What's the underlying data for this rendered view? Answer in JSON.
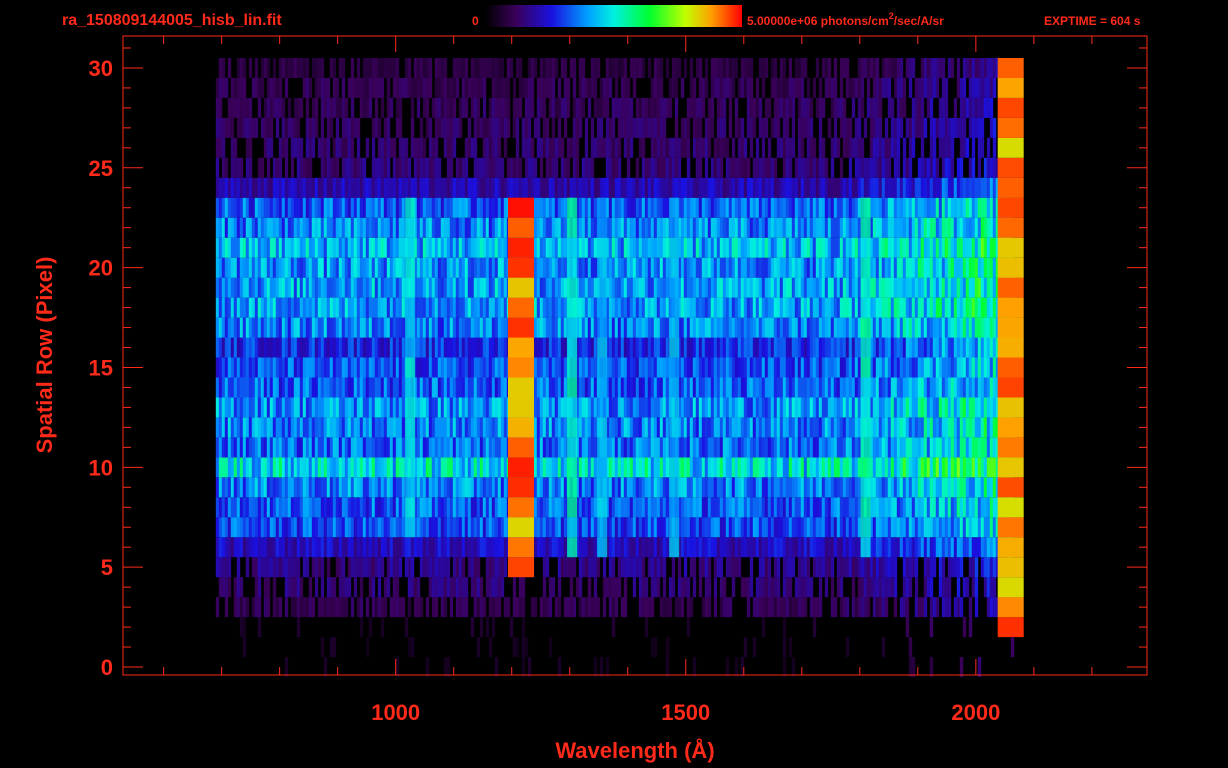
{
  "header": {
    "filename": "ra_150809144005_hisb_lin.fit",
    "scale_min_label": "0",
    "scale_max_label": "5.00000e+06 photons/cm",
    "scale_max_exp": "2",
    "scale_max_tail": "/sec/A/sr",
    "exptime": "EXPTIME = 604 s"
  },
  "colors": {
    "text": "#ff2a1a",
    "axis": "#ff2a1a",
    "background": "#000000"
  },
  "chart_data": {
    "type": "heatmap",
    "xlabel": "Wavelength (Å)",
    "ylabel": "Spatial Row (Pixel)",
    "x_ticks": [
      "1000",
      "1500",
      "2000"
    ],
    "y_ticks": [
      "0",
      "5",
      "10",
      "15",
      "20",
      "25",
      "30"
    ],
    "xlim": [
      530,
      2295
    ],
    "ylim": [
      -0.4,
      31.6
    ],
    "grid": false,
    "colorbar": {
      "min": "0",
      "max": "5.00000e+06",
      "units": "photons/cm^2/sec/A/sr",
      "colormap": "rainbow"
    },
    "exposure_time_s": 604,
    "detector_range_angstrom": [
      690,
      2065
    ],
    "rows": [
      {
        "row": 0,
        "level": 0.05
      },
      {
        "row": 1,
        "level": 0.05
      },
      {
        "row": 2,
        "level": 0.06
      },
      {
        "row": 3,
        "level": 0.12
      },
      {
        "row": 4,
        "level": 0.16
      },
      {
        "row": 5,
        "level": 0.18
      },
      {
        "row": 6,
        "level": 0.24
      },
      {
        "row": 7,
        "level": 0.34
      },
      {
        "row": 8,
        "level": 0.36
      },
      {
        "row": 9,
        "level": 0.4
      },
      {
        "row": 10,
        "level": 0.52
      },
      {
        "row": 11,
        "level": 0.38
      },
      {
        "row": 12,
        "level": 0.4
      },
      {
        "row": 13,
        "level": 0.42
      },
      {
        "row": 14,
        "level": 0.36
      },
      {
        "row": 15,
        "level": 0.34
      },
      {
        "row": 16,
        "level": 0.3
      },
      {
        "row": 17,
        "level": 0.4
      },
      {
        "row": 18,
        "level": 0.44
      },
      {
        "row": 19,
        "level": 0.44
      },
      {
        "row": 20,
        "level": 0.42
      },
      {
        "row": 21,
        "level": 0.46
      },
      {
        "row": 22,
        "level": 0.4
      },
      {
        "row": 23,
        "level": 0.36
      },
      {
        "row": 24,
        "level": 0.22
      },
      {
        "row": 25,
        "level": 0.16
      },
      {
        "row": 26,
        "level": 0.15
      },
      {
        "row": 27,
        "level": 0.14
      },
      {
        "row": 28,
        "level": 0.13
      },
      {
        "row": 29,
        "level": 0.12
      },
      {
        "row": 30,
        "level": 0.1
      }
    ],
    "emission_lines": [
      {
        "wavelength": 1216,
        "rows": [
          5,
          23
        ],
        "peak": 0.95
      },
      {
        "wavelength": 1304,
        "rows": [
          6,
          23
        ],
        "peak": 0.55
      },
      {
        "wavelength": 1025,
        "rows": [
          7,
          23
        ],
        "peak": 0.5
      },
      {
        "wavelength": 1356,
        "rows": [
          6,
          23
        ],
        "peak": 0.45
      },
      {
        "wavelength": 1480,
        "rows": [
          6,
          23
        ],
        "peak": 0.45
      },
      {
        "wavelength": 1810,
        "rows": [
          6,
          23
        ],
        "peak": 0.55
      },
      {
        "wavelength": 2060,
        "rows": [
          2,
          30
        ],
        "peak": 0.95
      }
    ]
  }
}
